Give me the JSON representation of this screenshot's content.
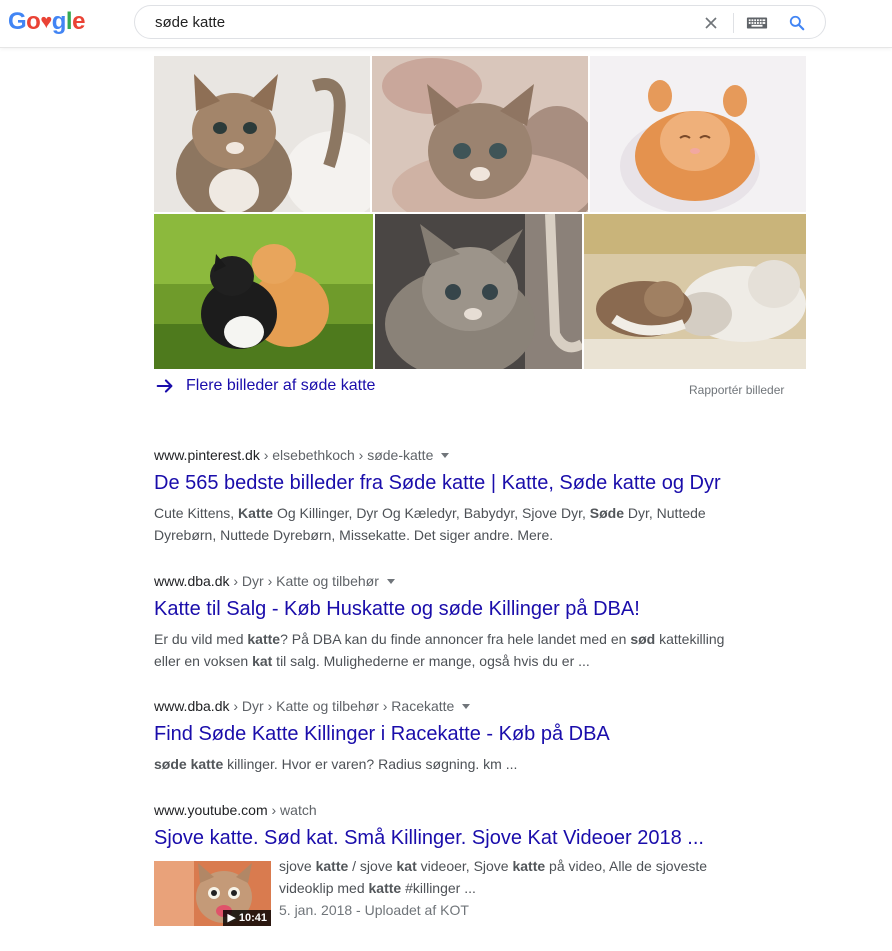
{
  "header": {
    "logo_letters": [
      "G",
      "o",
      "♥",
      "g",
      "l",
      "e"
    ],
    "logo_colors": [
      "#4285f4",
      "#ea4335",
      "#ea4335",
      "#4285f4",
      "#34a853",
      "#ea4335"
    ],
    "query": "søde katte"
  },
  "images": {
    "more_label": "Flere billeder af søde katte",
    "report_label": "Rapportér billeder"
  },
  "results": [
    {
      "domain": "www.pinterest.dk",
      "path": " › elsebethkoch › søde-katte",
      "title": "De 565 bedste billeder fra Søde katte | Katte, Søde katte og Dyr",
      "snippet_parts": [
        {
          "t": "Cute Kittens, ",
          "b": false
        },
        {
          "t": "Katte",
          "b": true
        },
        {
          "t": " Og Killinger, Dyr Og Kæledyr, Babydyr, Sjove Dyr, ",
          "b": false
        },
        {
          "t": "Søde",
          "b": true
        },
        {
          "t": " Dyr, Nuttede Dyrebørn, Nuttede Dyrebørn, Missekatte. Det siger andre. Mere.",
          "b": false
        }
      ]
    },
    {
      "domain": "www.dba.dk",
      "path": " › Dyr › Katte og tilbehør",
      "title": "Katte til Salg - Køb Huskatte og søde Killinger på DBA!",
      "snippet_parts": [
        {
          "t": "Er du vild med ",
          "b": false
        },
        {
          "t": "katte",
          "b": true
        },
        {
          "t": "? På DBA kan du finde annoncer fra hele landet med en ",
          "b": false
        },
        {
          "t": "sød",
          "b": true
        },
        {
          "t": " kattekilling eller en voksen ",
          "b": false
        },
        {
          "t": "kat",
          "b": true
        },
        {
          "t": " til salg. Mulighederne er mange, også hvis du er ...",
          "b": false
        }
      ]
    },
    {
      "domain": "www.dba.dk",
      "path": " › Dyr › Katte og tilbehør › Racekatte",
      "title": "Find Søde Katte Killinger i Racekatte - Køb på DBA",
      "snippet_parts": [
        {
          "t": "søde katte",
          "b": true
        },
        {
          "t": " killinger. Hvor er varen? Radius søgning. km ...",
          "b": false
        }
      ]
    },
    {
      "domain": "www.youtube.com",
      "path": " › watch",
      "title": "Sjove katte. Sød kat. Små Killinger. Sjove Kat Videoer 2018 ...",
      "video_duration": "▶ 10:41",
      "snippet_parts": [
        {
          "t": "sjove ",
          "b": false
        },
        {
          "t": "katte",
          "b": true
        },
        {
          "t": " / sjove ",
          "b": false
        },
        {
          "t": "kat",
          "b": true
        },
        {
          "t": " videoer, Sjove ",
          "b": false
        },
        {
          "t": "katte",
          "b": true
        },
        {
          "t": " på video, Alle de sjoveste videoklip med ",
          "b": false
        },
        {
          "t": "katte",
          "b": true
        },
        {
          "t": " #killinger ...",
          "b": false
        }
      ],
      "date_line": "5. jan. 2018 - Uploadet af KOT"
    }
  ],
  "colors": {
    "link": "#1a0dab",
    "snippet": "#4d5156",
    "cite": "#202124",
    "muted": "#70757a"
  }
}
